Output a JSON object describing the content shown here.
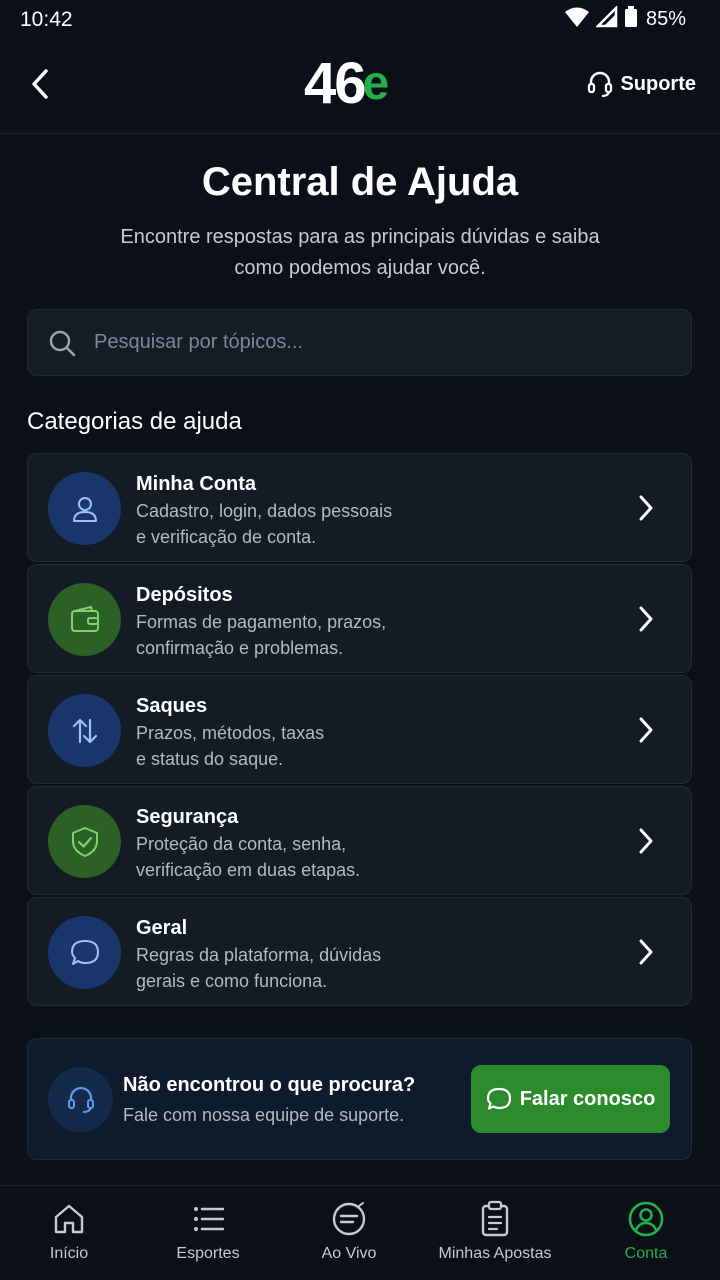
{
  "status": {
    "time": "10:42",
    "battery": "85%"
  },
  "header": {
    "logo_main": "46",
    "logo_accent": "e",
    "support_label": "Suporte"
  },
  "page": {
    "title": "Central de Ajuda",
    "subtitle": "Encontre respostas para as principais dúvidas e saiba como podemos ajudar você."
  },
  "search": {
    "placeholder": "Pesquisar por tópicos..."
  },
  "categories": {
    "heading": "Categorias de ajuda",
    "items": [
      {
        "title": "Minha Conta",
        "desc": "Cadastro, login, dados pessoais\ne verificação de conta.",
        "icon": "user-icon",
        "color": "#19376b"
      },
      {
        "title": "Depósitos",
        "desc": "Formas de pagamento, prazos,\nconfirmação e problemas.",
        "icon": "wallet-icon",
        "color": "#2b6125"
      },
      {
        "title": "Saques",
        "desc": "Prazos, métodos, taxas\ne status do saque.",
        "icon": "arrows-up-down-icon",
        "color": "#19376b"
      },
      {
        "title": "Segurança",
        "desc": "Proteção da conta, senha,\nverificação em duas etapas.",
        "icon": "shield-check-icon",
        "color": "#2b6125"
      },
      {
        "title": "Geral",
        "desc": "Regras da plataforma, dúvidas\ngerais e como funciona.",
        "icon": "chat-bubble-icon",
        "color": "#19376b"
      }
    ]
  },
  "contact": {
    "title": "Não encontrou o que procura?",
    "subtitle": "Fale com nossa equipe de suporte.",
    "button_label": "Falar conosco"
  },
  "nav": {
    "items": [
      {
        "label": "Início",
        "icon": "home-icon"
      },
      {
        "label": "Esportes",
        "icon": "list-icon"
      },
      {
        "label": "Ao Vivo",
        "icon": "live-icon"
      },
      {
        "label": "Minhas Apostas",
        "icon": "clipboard-icon"
      },
      {
        "label": "Conta",
        "icon": "account-icon",
        "active": true
      }
    ]
  },
  "colors": {
    "accent_green": "#22b14c",
    "button_green": "#2c8c2c",
    "background": "#0b0f17"
  }
}
